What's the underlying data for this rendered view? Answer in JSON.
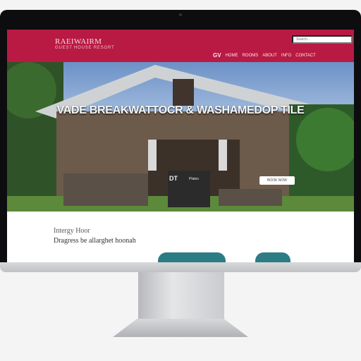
{
  "header": {
    "logo_title": "RAEIWAIRM",
    "logo_subtitle": "GUEST HOUSE RESORT",
    "search_placeholder": "Search...",
    "nav": {
      "first": "GV",
      "items": [
        "HOME",
        "ROOMS",
        "ABOUT",
        "INFO"
      ],
      "contact": "CONTACT"
    }
  },
  "hero": {
    "headline": "VADE BREAKWATTOCR & WASHAMEDOP TILE",
    "button_label": "BOOK NOW",
    "mailbox_label": "DT",
    "mailbox_sublabel": "Plates"
  },
  "content": {
    "title": "Intergy Hoor",
    "subtitle": "Dragress be allarghet hoonah"
  },
  "colors": {
    "brand": "#b81a43",
    "accent_card": "#2c7c86"
  }
}
